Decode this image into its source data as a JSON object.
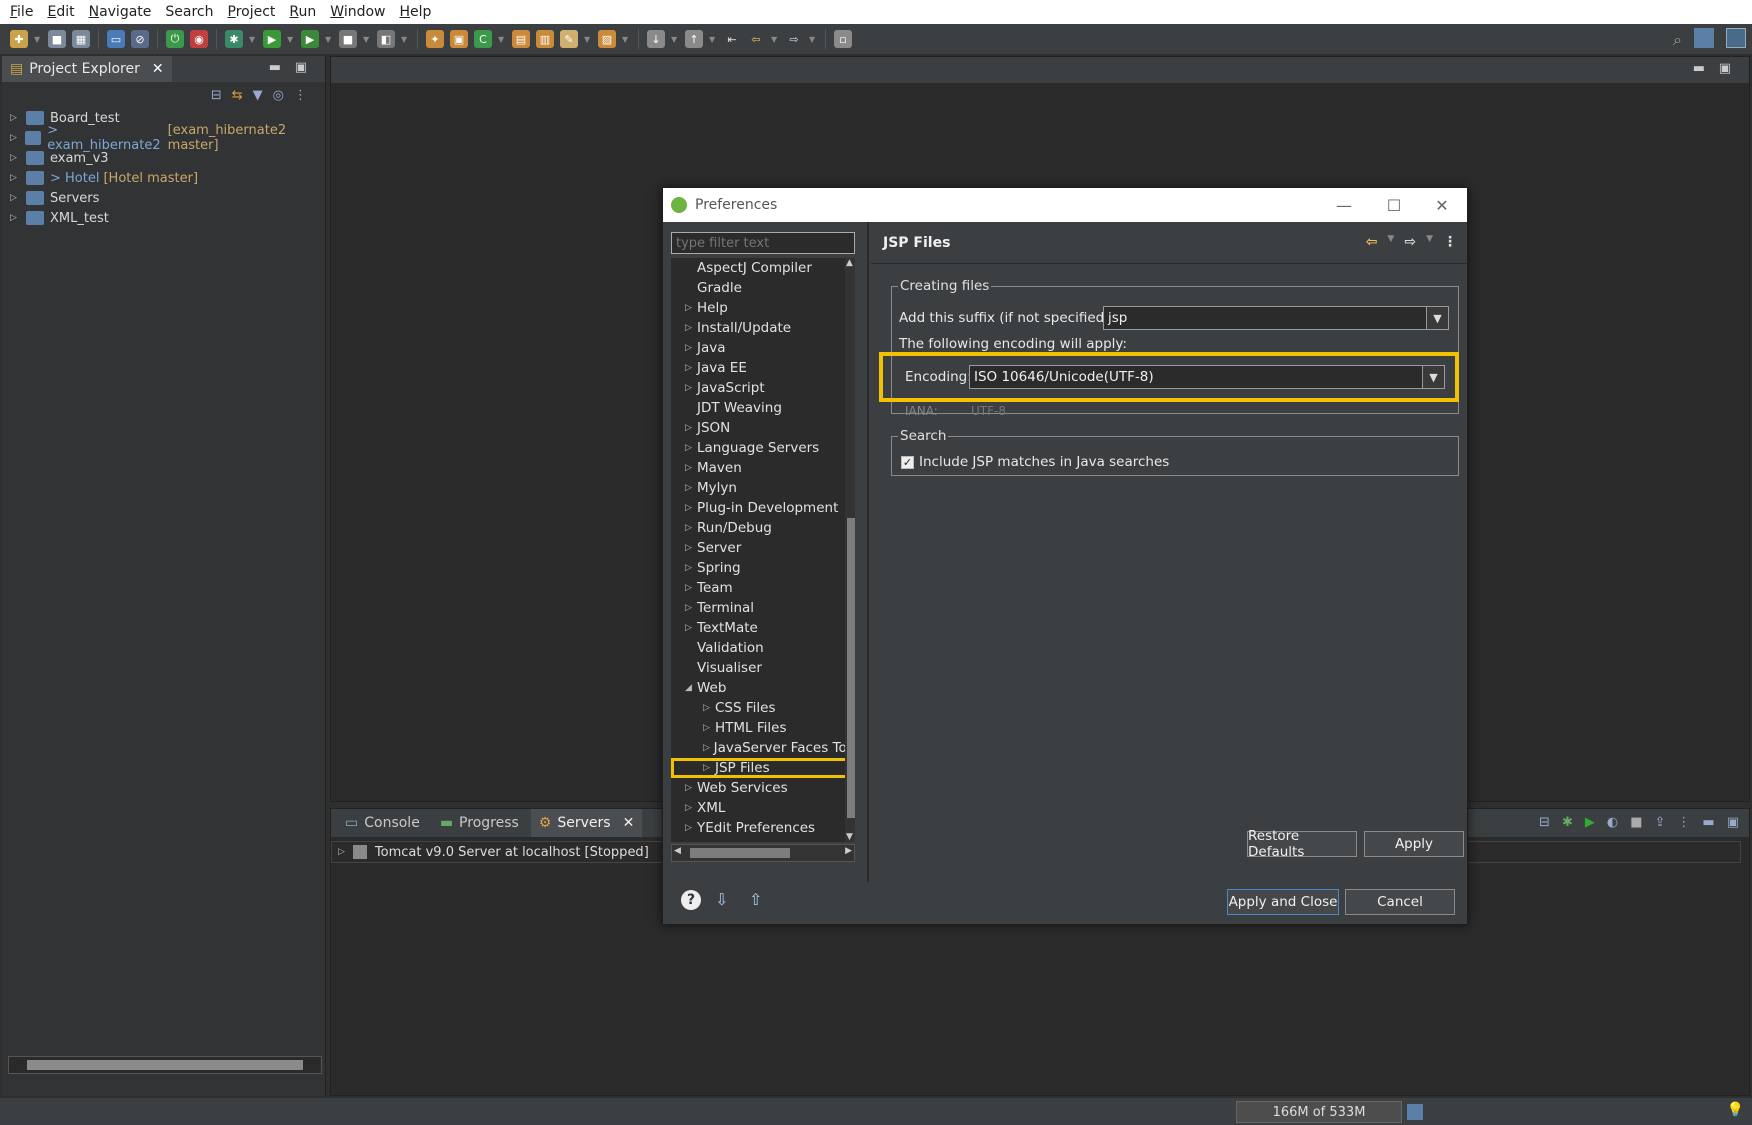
{
  "menu": [
    "File",
    "Edit",
    "Navigate",
    "Search",
    "Project",
    "Run",
    "Window",
    "Help"
  ],
  "menu_mnemonic": [
    "F",
    "E",
    "N",
    "",
    "P",
    "R",
    "W",
    "H"
  ],
  "explorer": {
    "tab_label": "Project Explorer",
    "items": [
      {
        "label": "Board_test",
        "prefix": "",
        "repo": ""
      },
      {
        "label": "exam_hibernate2",
        "prefix": "> ",
        "repo": "[exam_hibernate2 master]"
      },
      {
        "label": "exam_v3",
        "prefix": "",
        "repo": ""
      },
      {
        "label": "Hotel",
        "prefix": "> ",
        "repo": "[Hotel master]"
      },
      {
        "label": "Servers",
        "prefix": "",
        "repo": ""
      },
      {
        "label": "XML_test",
        "prefix": "",
        "repo": ""
      }
    ]
  },
  "bottom_panel": {
    "tabs": [
      "Console",
      "Progress",
      "Servers"
    ],
    "active_tab": "Servers",
    "server_row": "Tomcat v9.0 Server at localhost  [Stopped]"
  },
  "status": {
    "heap": "166M of 533M"
  },
  "prefs": {
    "title": "Preferences",
    "filter_placeholder": "type filter text",
    "tree": [
      {
        "label": "AspectJ Compiler",
        "level": 1,
        "expandable": false
      },
      {
        "label": "Gradle",
        "level": 1,
        "expandable": false
      },
      {
        "label": "Help",
        "level": 1,
        "expandable": true
      },
      {
        "label": "Install/Update",
        "level": 1,
        "expandable": true
      },
      {
        "label": "Java",
        "level": 1,
        "expandable": true
      },
      {
        "label": "Java EE",
        "level": 1,
        "expandable": true
      },
      {
        "label": "JavaScript",
        "level": 1,
        "expandable": true
      },
      {
        "label": "JDT Weaving",
        "level": 1,
        "expandable": false
      },
      {
        "label": "JSON",
        "level": 1,
        "expandable": true
      },
      {
        "label": "Language Servers",
        "level": 1,
        "expandable": true
      },
      {
        "label": "Maven",
        "level": 1,
        "expandable": true
      },
      {
        "label": "Mylyn",
        "level": 1,
        "expandable": true
      },
      {
        "label": "Plug-in Development",
        "level": 1,
        "expandable": true
      },
      {
        "label": "Run/Debug",
        "level": 1,
        "expandable": true
      },
      {
        "label": "Server",
        "level": 1,
        "expandable": true
      },
      {
        "label": "Spring",
        "level": 1,
        "expandable": true
      },
      {
        "label": "Team",
        "level": 1,
        "expandable": true
      },
      {
        "label": "Terminal",
        "level": 1,
        "expandable": true
      },
      {
        "label": "TextMate",
        "level": 1,
        "expandable": true
      },
      {
        "label": "Validation",
        "level": 1,
        "expandable": false
      },
      {
        "label": "Visualiser",
        "level": 1,
        "expandable": false
      },
      {
        "label": "Web",
        "level": 1,
        "expandable": "open"
      },
      {
        "label": "CSS Files",
        "level": 2,
        "expandable": true
      },
      {
        "label": "HTML Files",
        "level": 2,
        "expandable": true
      },
      {
        "label": "JavaServer Faces Too",
        "level": 2,
        "expandable": true
      },
      {
        "label": "JSP Files",
        "level": 2,
        "expandable": true,
        "selected": true
      },
      {
        "label": "Web Services",
        "level": 1,
        "expandable": true
      },
      {
        "label": "XML",
        "level": 1,
        "expandable": true
      },
      {
        "label": "YEdit Preferences",
        "level": 1,
        "expandable": true
      }
    ],
    "page_title": "JSP Files",
    "creating_files_legend": "Creating files",
    "suffix_label": "Add this suffix (if not specified):",
    "suffix_value": "jsp",
    "encoding_note": "The following encoding will apply:",
    "encoding_label": "Encoding:",
    "encoding_value": "ISO 10646/Unicode(UTF-8)",
    "iana_label": "IANA:",
    "iana_value": "UTF-8",
    "search_legend": "Search",
    "include_jsp_label": "Include JSP matches in Java searches",
    "include_jsp_checked": true,
    "restore_defaults": "Restore Defaults",
    "apply": "Apply",
    "apply_and_close": "Apply and Close",
    "cancel": "Cancel"
  },
  "colors": {
    "highlight": "#f2c200",
    "background": "#2b2b2b",
    "panel": "#3c3f41"
  }
}
